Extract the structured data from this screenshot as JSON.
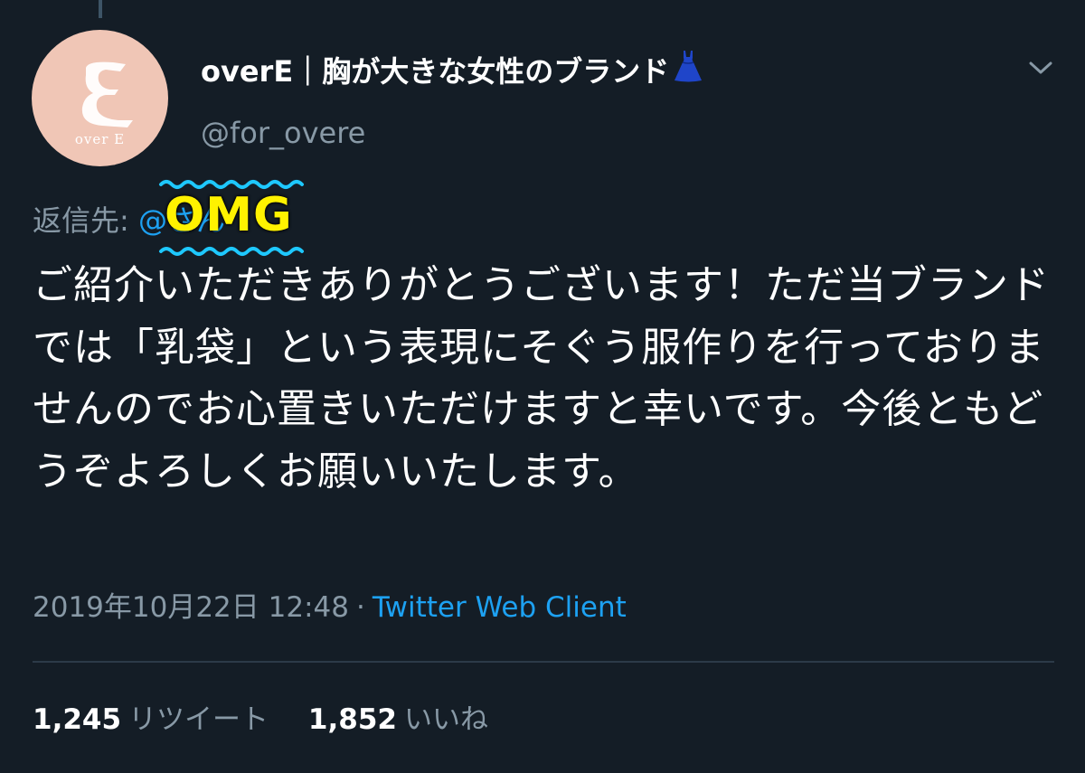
{
  "user": {
    "display_name": "overE｜胸が大きな女性のブランド",
    "handle": "@for_overe",
    "avatar_text": "over E"
  },
  "reply": {
    "prefix": "返信先: ",
    "mention": "@さん"
  },
  "sticker": {
    "text": "OMG",
    "color": "#fff200",
    "wave_color": "#1ec8ff"
  },
  "tweet": {
    "text": "ご紹介いただきありがとうございます！ただ当ブランドでは「乳袋」という表現にそぐう服作りを行っておりませんのでお心置きいただけますと幸いです。今後ともどうぞよろしくお願いいたします。"
  },
  "meta": {
    "timestamp": "2019年10月22日 12:48",
    "separator": "·",
    "client": "Twitter Web Client"
  },
  "stats": {
    "retweets_count": "1,245",
    "retweets_label": "リツイート",
    "likes_count": "1,852",
    "likes_label": "いいね"
  },
  "colors": {
    "background": "#141d26",
    "text": "#ffffff",
    "secondary": "#8899a6",
    "link": "#1da1f2",
    "avatar_bg": "#f0c6b6"
  },
  "icons": {
    "caret": "chevron-down-icon",
    "dress": "dress-emoji-icon"
  }
}
